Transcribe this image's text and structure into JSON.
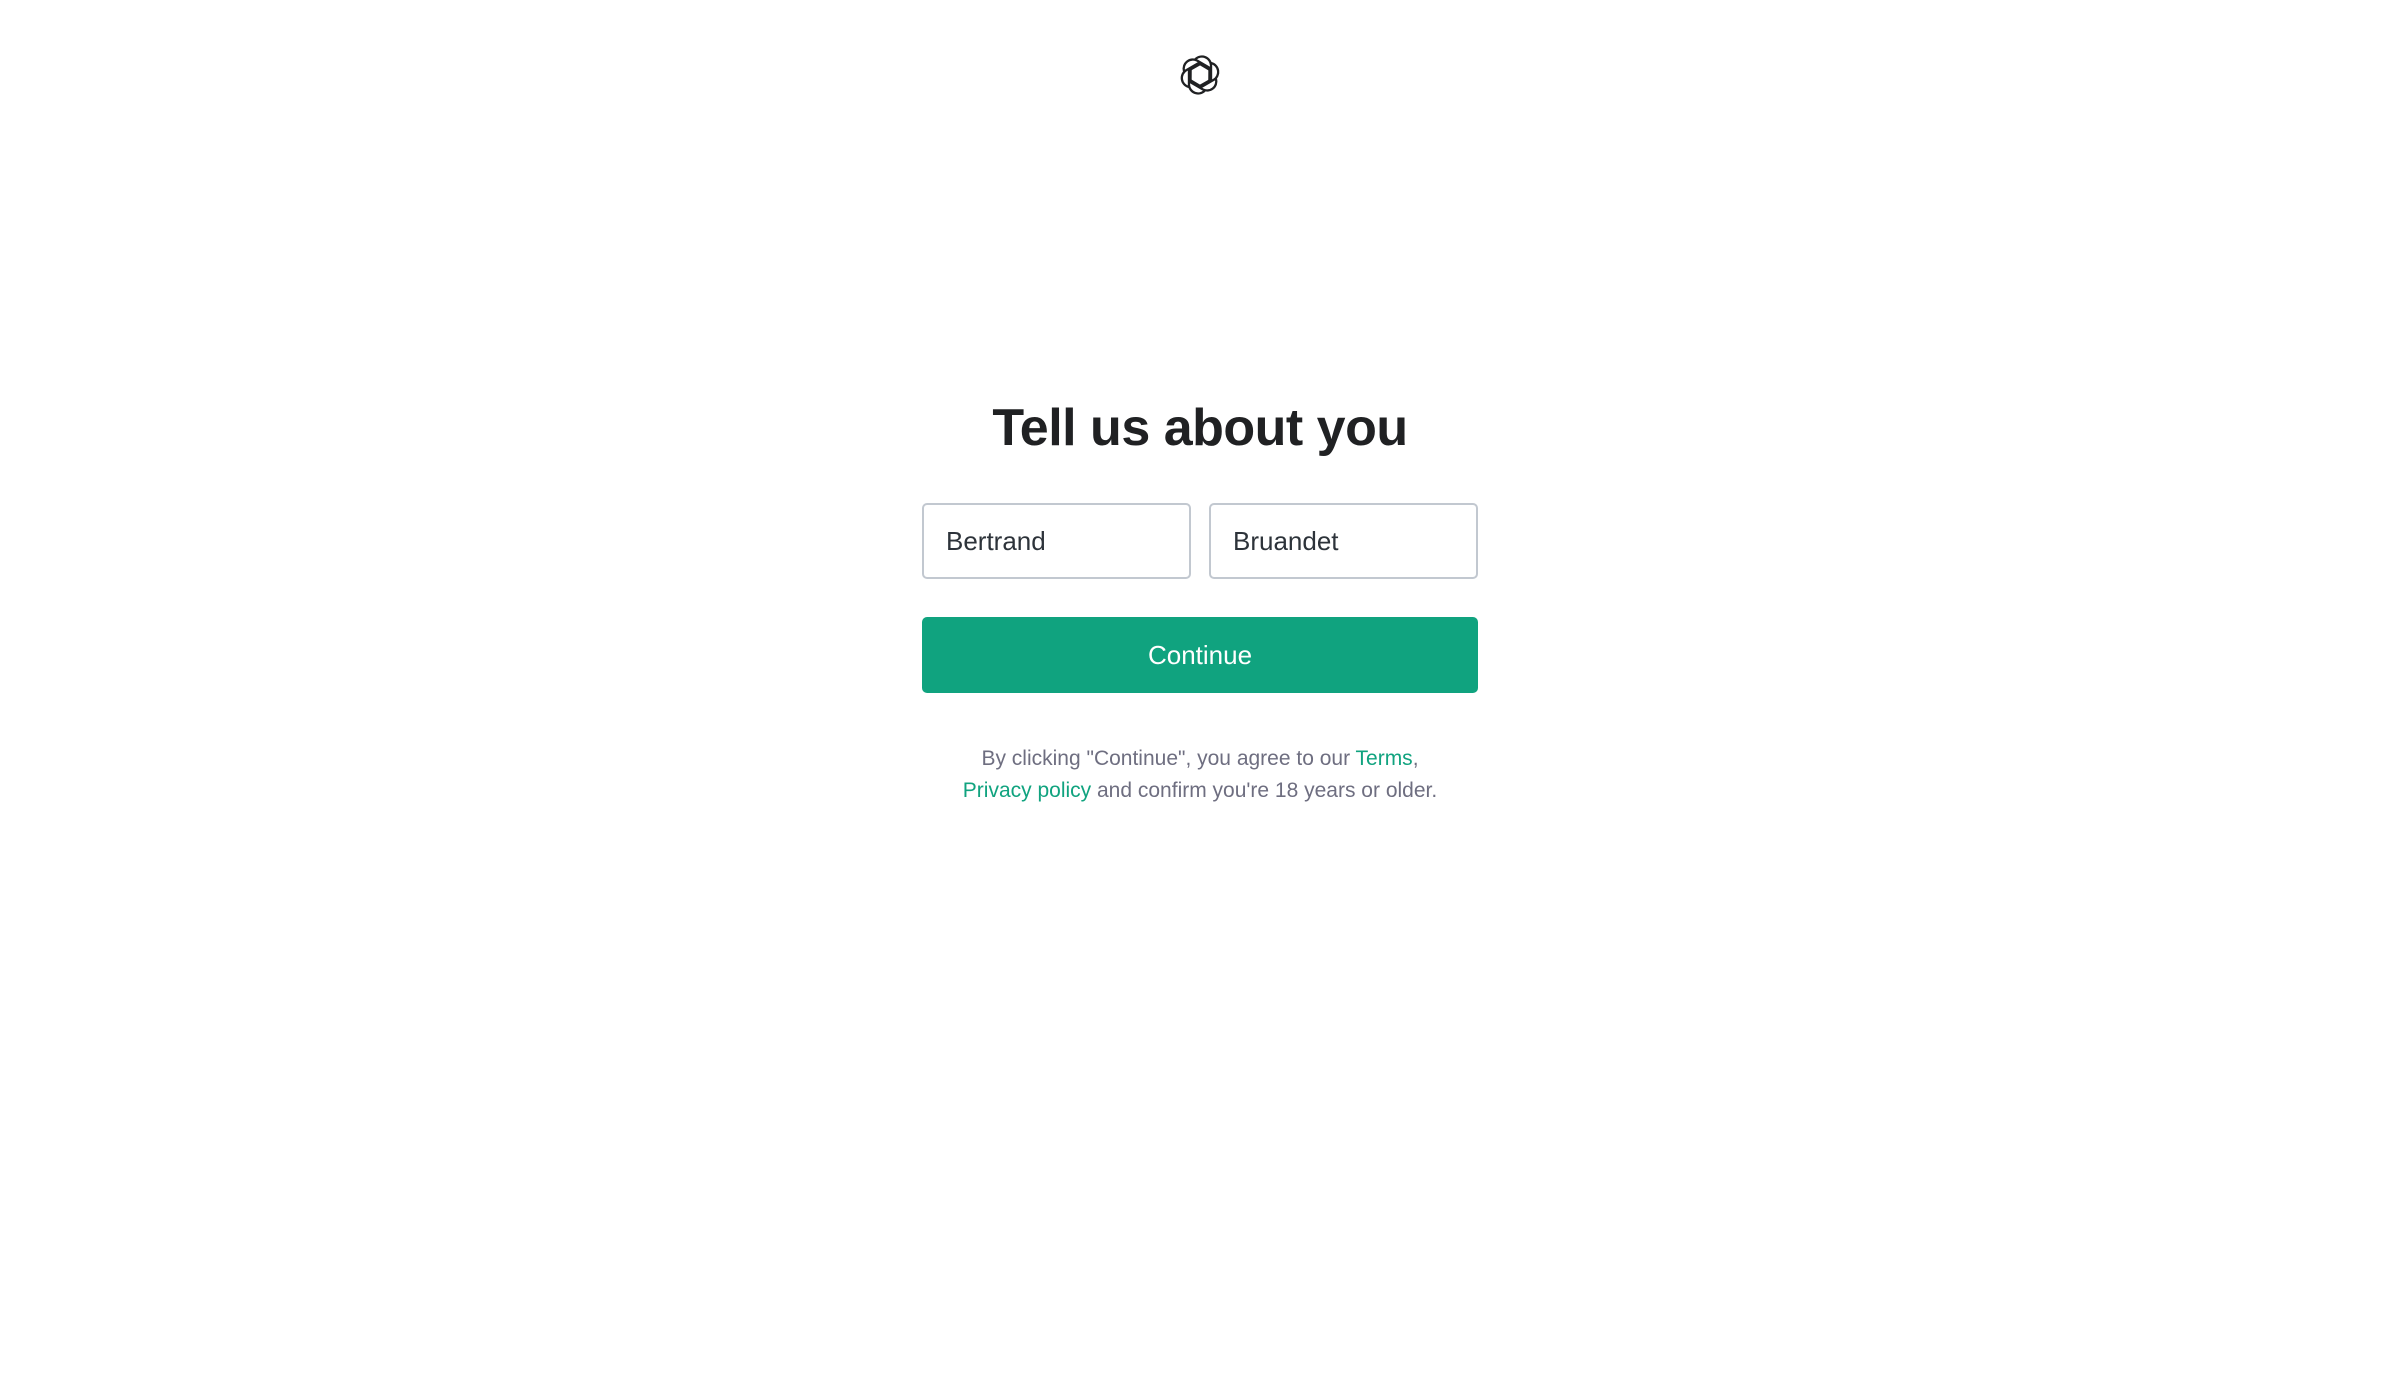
{
  "brand": {
    "logo_icon": "openai-logo-icon",
    "accent_color": "#10a37f"
  },
  "form": {
    "title": "Tell us about you",
    "first_name_value": "Bertrand",
    "last_name_value": "Bruandet",
    "continue_label": "Continue"
  },
  "legal": {
    "prefix": "By clicking \"Continue\", you agree to our ",
    "terms_link": "Terms",
    "comma": ",",
    "privacy_link": "Privacy policy",
    "suffix": " and confirm you're 18 years or older."
  }
}
